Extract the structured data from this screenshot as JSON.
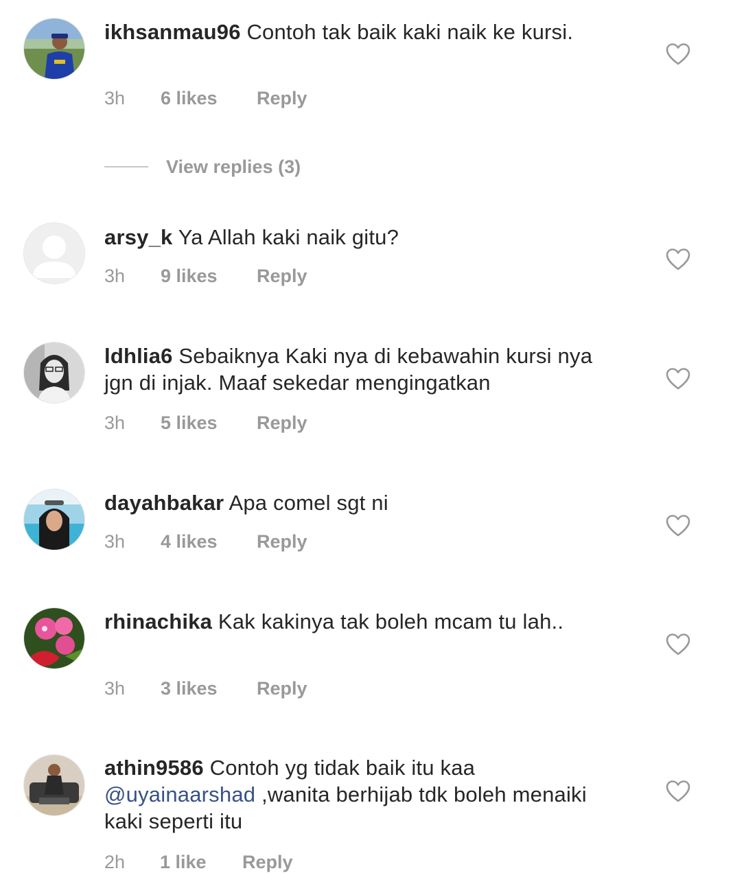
{
  "comments": [
    {
      "username": "ikhsanmau96",
      "text": "Contoh tak baik kaki naik ke kursi.",
      "time": "3h",
      "likes": "6 likes",
      "reply": "Reply",
      "avatar": "avatar-man-outdoors"
    },
    {
      "username": "arsy_k",
      "text": "Ya Allah kaki naik gitu?",
      "time": "3h",
      "likes": "9 likes",
      "reply": "Reply",
      "avatar": "default-avatar"
    },
    {
      "username": "ldhlia6",
      "text": "Sebaiknya Kaki nya di kebawahin kursi nya jgn di injak. Maaf sekedar mengingatkan",
      "time": "3h",
      "likes": "5 likes",
      "reply": "Reply",
      "avatar": "avatar-girl-bw"
    },
    {
      "username": "dayahbakar",
      "text": "Apa comel sgt ni",
      "time": "3h",
      "likes": "4 likes",
      "reply": "Reply",
      "avatar": "avatar-hijab-pool"
    },
    {
      "username": "rhinachika",
      "text": "Kak kakinya tak boleh mcam tu lah..",
      "time": "3h",
      "likes": "3 likes",
      "reply": "Reply",
      "avatar": "avatar-flowers"
    },
    {
      "username": "athin9586",
      "text_before": "Contoh yg tidak baik itu kaa",
      "mention": "@uyainaarshad",
      "text_after": " ,wanita berhijab tdk boleh menaiki kaki seperti itu",
      "time": "2h",
      "likes": "1 like",
      "reply": "Reply",
      "avatar": "avatar-man-seated"
    }
  ],
  "view_replies": "View replies (3)",
  "icons": {
    "like": "heart-outline-icon"
  },
  "colors": {
    "text": "#262626",
    "meta": "#999999",
    "mention": "#385185",
    "divider": "#c7c7c7"
  }
}
